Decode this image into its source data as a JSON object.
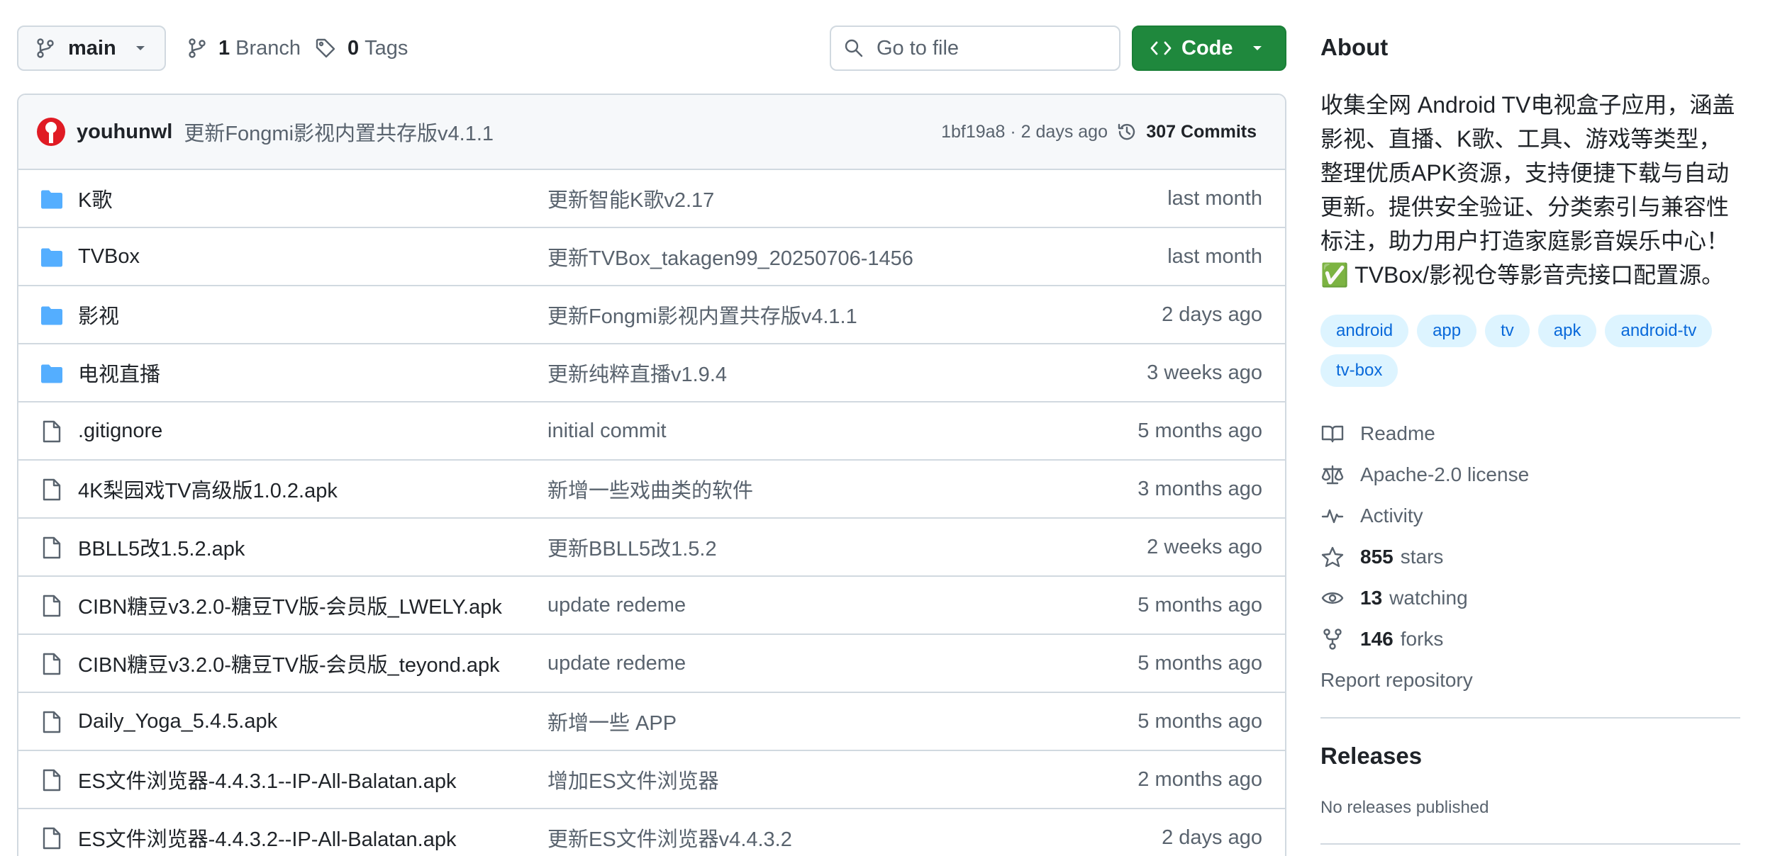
{
  "toolbar": {
    "branch": "main",
    "branch_count": "1",
    "branch_label": "Branch",
    "tag_count": "0",
    "tag_label": "Tags",
    "search_placeholder": "Go to file",
    "code_label": "Code"
  },
  "latest_commit": {
    "author": "youhunwl",
    "message": "更新Fongmi影视内置共存版v4.1.1",
    "meta": "1bf19a8 · 2 days ago",
    "commits_label": "307 Commits"
  },
  "files": [
    {
      "type": "folder",
      "name": "K歌",
      "message": "更新智能K歌v2.17",
      "age": "last month"
    },
    {
      "type": "folder",
      "name": "TVBox",
      "message": "更新TVBox_takagen99_20250706-1456",
      "age": "last month"
    },
    {
      "type": "folder",
      "name": "影视",
      "message": "更新Fongmi影视内置共存版v4.1.1",
      "age": "2 days ago"
    },
    {
      "type": "folder",
      "name": "电视直播",
      "message": "更新纯粹直播v1.9.4",
      "age": "3 weeks ago"
    },
    {
      "type": "file",
      "name": ".gitignore",
      "message": "initial commit",
      "age": "5 months ago"
    },
    {
      "type": "file",
      "name": "4K梨园戏TV高级版1.0.2.apk",
      "message": "新增一些戏曲类的软件",
      "age": "3 months ago"
    },
    {
      "type": "file",
      "name": "BBLL5改1.5.2.apk",
      "message": "更新BBLL5改1.5.2",
      "age": "2 weeks ago"
    },
    {
      "type": "file",
      "name": "CIBN糖豆v3.2.0-糖豆TV版-会员版_LWELY.apk",
      "message": "update redeme",
      "age": "5 months ago"
    },
    {
      "type": "file",
      "name": "CIBN糖豆v3.2.0-糖豆TV版-会员版_teyond.apk",
      "message": "update redeme",
      "age": "5 months ago"
    },
    {
      "type": "file",
      "name": "Daily_Yoga_5.4.5.apk",
      "message": "新增一些 APP",
      "age": "5 months ago"
    },
    {
      "type": "file",
      "name": "ES文件浏览器-4.4.3.1--IP-All-Balatan.apk",
      "message": "增加ES文件浏览器",
      "age": "2 months ago"
    },
    {
      "type": "file",
      "name": "ES文件浏览器-4.4.3.2--IP-All-Balatan.apk",
      "message": "更新ES文件浏览器v4.4.3.2",
      "age": "2 days ago"
    }
  ],
  "about": {
    "title": "About",
    "description_lines": [
      "收集全网 Android TV电视盒子应用，涵盖",
      "影视、直播、K歌、工具、游戏等类型，",
      "整理优质APK资源，支持便捷下载与自动",
      "更新。提供安全验证、分类索引与兼容性",
      "标注，助力用户打造家庭影音娱乐中心！",
      "✅ TVBox/影视仓等影音壳接口配置源。"
    ],
    "topics": [
      "android",
      "app",
      "tv",
      "apk",
      "android-tv",
      "tv-box"
    ],
    "readme": "Readme",
    "license": "Apache-2.0 license",
    "activity": "Activity",
    "stars_count": "855",
    "stars_label": "stars",
    "watching_count": "13",
    "watching_label": "watching",
    "forks_count": "146",
    "forks_label": "forks",
    "report": "Report repository"
  },
  "releases": {
    "title": "Releases",
    "empty": "No releases published"
  },
  "colors": {
    "accent": "#0969da",
    "code_button": "#1f883d",
    "folder": "#54aeff",
    "border": "#d1d9e0",
    "muted_text": "#59636e"
  }
}
